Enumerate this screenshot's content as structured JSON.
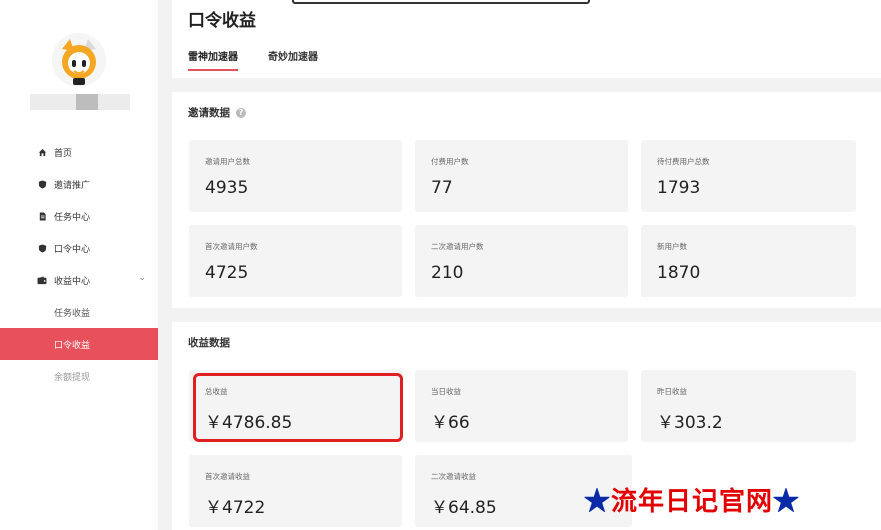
{
  "page_title": "口令收益",
  "tabs": [
    {
      "label": "雷神加速器",
      "active": true
    },
    {
      "label": "奇妙加速器",
      "active": false
    }
  ],
  "sidebar": {
    "items": [
      {
        "label": "首页",
        "icon": "home-icon"
      },
      {
        "label": "邀请推广",
        "icon": "shield-icon"
      },
      {
        "label": "任务中心",
        "icon": "document-icon"
      },
      {
        "label": "口令中心",
        "icon": "shield-icon"
      },
      {
        "label": "收益中心",
        "icon": "wallet-icon"
      }
    ],
    "sub_items": [
      {
        "label": "任务收益",
        "active": false
      },
      {
        "label": "口令收益",
        "active": true
      },
      {
        "label": "余额提现",
        "active": false
      }
    ]
  },
  "invite_section": {
    "title": "邀请数据",
    "cards": [
      {
        "label": "邀请用户总数",
        "value": "4935"
      },
      {
        "label": "付费用户数",
        "value": "77"
      },
      {
        "label": "待付费用户总数",
        "value": "1793"
      },
      {
        "label": "首次邀请用户数",
        "value": "4725"
      },
      {
        "label": "二次邀请用户数",
        "value": "210"
      },
      {
        "label": "新用户数",
        "value": "1870"
      }
    ]
  },
  "income_section": {
    "title": "收益数据",
    "cards": [
      {
        "label": "总收益",
        "value": "￥4786.85"
      },
      {
        "label": "当日收益",
        "value": "￥66"
      },
      {
        "label": "昨日收益",
        "value": "￥303.2"
      },
      {
        "label": "首次邀请收益",
        "value": "￥4722"
      },
      {
        "label": "二次邀请收益",
        "value": "￥64.85"
      }
    ]
  },
  "watermark": {
    "text": "流年日记官网",
    "star": "★"
  },
  "colors": {
    "accent": "#e8505b",
    "highlight": "#e02020",
    "watermark": "#e30000",
    "watermark_star": "#0b2aa8"
  }
}
